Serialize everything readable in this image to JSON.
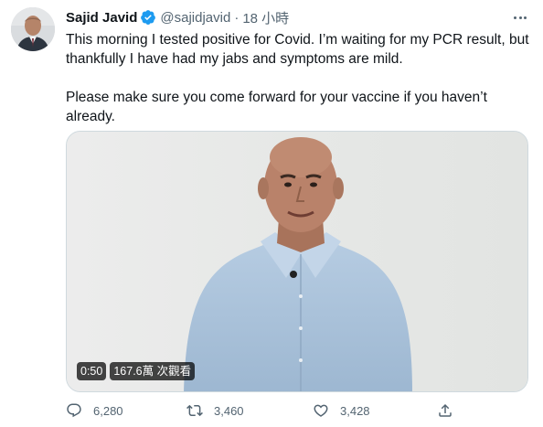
{
  "tweet": {
    "author_name": "Sajid Javid",
    "handle": "@sajidjavid",
    "separator": "·",
    "time": "18 小時",
    "text_para_1": "This morning I tested positive for Covid. I’m waiting for my PCR result, but thankfully I have had my jabs and symptoms are mild.",
    "text_para_2": "Please make sure you come forward for your vaccine if you haven’t already."
  },
  "media": {
    "duration": "0:50",
    "views": "167.6萬 次觀看"
  },
  "actions": {
    "reply_count": "6,280",
    "retweet_count": "3,460",
    "like_count": "3,428"
  },
  "colors": {
    "verified_blue": "#1d9bf0",
    "secondary_text": "#536471",
    "shirt_blue": "#a9c2db"
  },
  "icons": [
    "verified-badge-icon",
    "more-icon",
    "reply-icon",
    "retweet-icon",
    "like-icon",
    "share-icon"
  ]
}
